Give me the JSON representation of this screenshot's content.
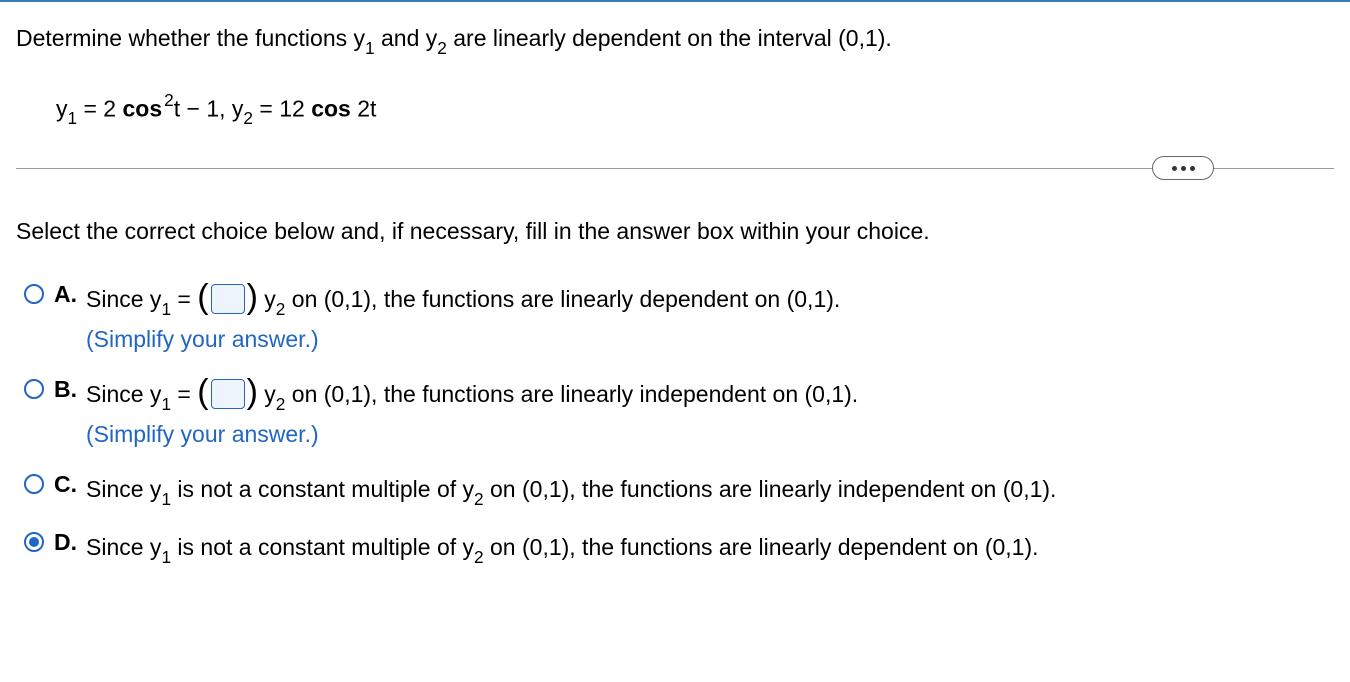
{
  "question": {
    "prompt_pre": "Determine whether the functions y",
    "prompt_sub1": "1",
    "prompt_mid": " and y",
    "prompt_sub2": "2",
    "prompt_post": " are linearly dependent on the interval (0,1).",
    "eq_y1_label": "y",
    "eq_y1_sub": "1",
    "eq_eq": " = 2 ",
    "eq_cos": "cos",
    "eq_sq_sup": "2",
    "eq_t_minus1": "t − 1, y",
    "eq_y2_sub": "2",
    "eq_y2_rhs": " = 12 ",
    "eq_cos2": "cos",
    "eq_2t": " 2t"
  },
  "instruction": "Select the correct choice below and, if necessary, fill in the answer box within your choice.",
  "choices": {
    "a": {
      "letter": "A.",
      "t1": "Since y",
      "s1": "1",
      "t2": " = ",
      "t3": " y",
      "s2": "2",
      "t4": " on (0,1), the functions are linearly dependent on (0,1).",
      "simplify": "(Simplify your answer.)"
    },
    "b": {
      "letter": "B.",
      "t1": "Since y",
      "s1": "1",
      "t2": " = ",
      "t3": " y",
      "s2": "2",
      "t4": " on (0,1), the functions are linearly independent on (0,1).",
      "simplify": "(Simplify your answer.)"
    },
    "c": {
      "letter": "C.",
      "t1": "Since y",
      "s1": "1",
      "t2": " is not a constant multiple of y",
      "s2": "2",
      "t3": " on (0,1), the functions are linearly independent on (0,1)."
    },
    "d": {
      "letter": "D.",
      "t1": "Since y",
      "s1": "1",
      "t2": " is not a constant multiple of y",
      "s2": "2",
      "t3": " on (0,1), the functions are linearly dependent on (0,1)."
    }
  },
  "selected": "d"
}
